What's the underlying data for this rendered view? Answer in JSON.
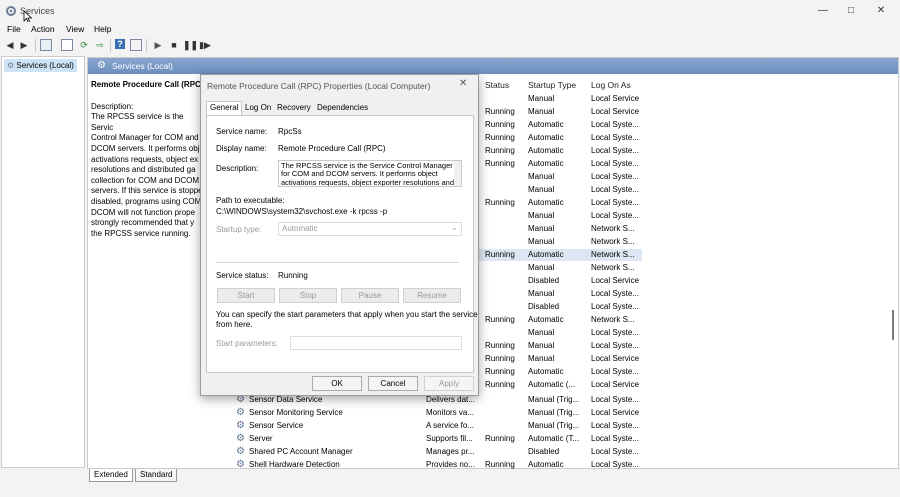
{
  "window": {
    "title": "Services"
  },
  "menu": [
    "File",
    "Action",
    "View",
    "Help"
  ],
  "tree": {
    "root": "Services (Local)"
  },
  "pane": {
    "header": "Services (Local)",
    "service_title": "Remote Procedure Call (RPC",
    "desc_label": "Description:",
    "desc_lines": [
      "The RPCSS service is the Servic",
      "Control Manager for COM and",
      "DCOM servers. It performs obj",
      "activations requests, object ex",
      "resolutions and distributed ga",
      "collection for COM and DCOM",
      "servers. If this service is stoppe",
      "disabled, programs using COM",
      "DCOM will not function prope",
      "strongly recommended that y",
      "the RPCSS service running."
    ],
    "columns": {
      "status": "Status",
      "startup": "Startup Type",
      "logon": "Log On As"
    }
  },
  "services_top": [
    {
      "status": "",
      "startup": "Manual",
      "logon": "Local Service"
    },
    {
      "status": "Running",
      "startup": "Manual",
      "logon": "Local Service"
    },
    {
      "status": "Running",
      "startup": "Automatic",
      "logon": "Local Syste..."
    },
    {
      "status": "Running",
      "startup": "Automatic",
      "logon": "Local Syste..."
    },
    {
      "status": "Running",
      "startup": "Automatic",
      "logon": "Local Syste..."
    },
    {
      "status": "Running",
      "startup": "Automatic",
      "logon": "Local Syste..."
    },
    {
      "status": "",
      "startup": "Manual",
      "logon": "Local Syste..."
    },
    {
      "status": "",
      "startup": "Manual",
      "logon": "Local Syste..."
    },
    {
      "status": "Running",
      "startup": "Automatic",
      "logon": "Local Syste..."
    },
    {
      "status": "",
      "startup": "Manual",
      "logon": "Local Syste..."
    },
    {
      "status": "",
      "startup": "Manual",
      "logon": "Network S..."
    },
    {
      "status": "",
      "startup": "Manual",
      "logon": "Network S..."
    },
    {
      "status": "Running",
      "startup": "Automatic",
      "logon": "Network S..."
    },
    {
      "status": "",
      "startup": "Manual",
      "logon": "Network S..."
    },
    {
      "status": "",
      "startup": "Disabled",
      "logon": "Local Service"
    },
    {
      "status": "",
      "startup": "Manual",
      "logon": "Local Syste..."
    },
    {
      "status": "",
      "startup": "Disabled",
      "logon": "Local Syste..."
    },
    {
      "status": "Running",
      "startup": "Automatic",
      "logon": "Network S..."
    },
    {
      "status": "",
      "startup": "Manual",
      "logon": "Local Syste..."
    },
    {
      "status": "Running",
      "startup": "Manual",
      "logon": "Local Syste..."
    },
    {
      "status": "Running",
      "startup": "Manual",
      "logon": "Local Service"
    },
    {
      "status": "Running",
      "startup": "Automatic",
      "logon": "Local Syste..."
    },
    {
      "status": "Running",
      "startup": "Automatic (...",
      "logon": "Local Service"
    }
  ],
  "services_bottom": [
    {
      "name": "Sensor Data Service",
      "desc": "Delivers dat...",
      "status": "",
      "startup": "Manual (Trig...",
      "logon": "Local Syste..."
    },
    {
      "name": "Sensor Monitoring Service",
      "desc": "Monitors va...",
      "status": "",
      "startup": "Manual (Trig...",
      "logon": "Local Service"
    },
    {
      "name": "Sensor Service",
      "desc": "A service fo...",
      "status": "",
      "startup": "Manual (Trig...",
      "logon": "Local Syste..."
    },
    {
      "name": "Server",
      "desc": "Supports fil...",
      "status": "Running",
      "startup": "Automatic (T...",
      "logon": "Local Syste..."
    },
    {
      "name": "Shared PC Account Manager",
      "desc": "Manages pr...",
      "status": "",
      "startup": "Disabled",
      "logon": "Local Syste..."
    },
    {
      "name": "Shell Hardware Detection",
      "desc": "Provides no...",
      "status": "Running",
      "startup": "Automatic",
      "logon": "Local Syste..."
    }
  ],
  "tabs": {
    "extended": "Extended",
    "standard": "Standard"
  },
  "dialog": {
    "title": "Remote Procedure Call (RPC) Properties (Local Computer)",
    "tabs": [
      "General",
      "Log On",
      "Recovery",
      "Dependencies"
    ],
    "service_name_label": "Service name:",
    "service_name": "RpcSs",
    "display_name_label": "Display name:",
    "display_name": "Remote Procedure Call (RPC)",
    "description_label": "Description:",
    "description_lines": [
      "The RPCSS service is the Service Control Manager",
      "for COM and DCOM servers. It performs object",
      "activations requests, object exporter resolutions and"
    ],
    "path_label": "Path to executable:",
    "path": "C:\\WINDOWS\\system32\\svchost.exe -k rpcss -p",
    "startup_type_label": "Startup type:",
    "startup_type": "Automatic",
    "status_label": "Service status:",
    "status": "Running",
    "start_btn": "Start",
    "stop_btn": "Stop",
    "pause_btn": "Pause",
    "resume_btn": "Resume",
    "hint_line1": "You can specify the start parameters that apply when you start the service",
    "hint_line2": "from here.",
    "params_label": "Start parameters:",
    "params_value": "",
    "ok": "OK",
    "cancel": "Cancel",
    "apply": "Apply"
  }
}
